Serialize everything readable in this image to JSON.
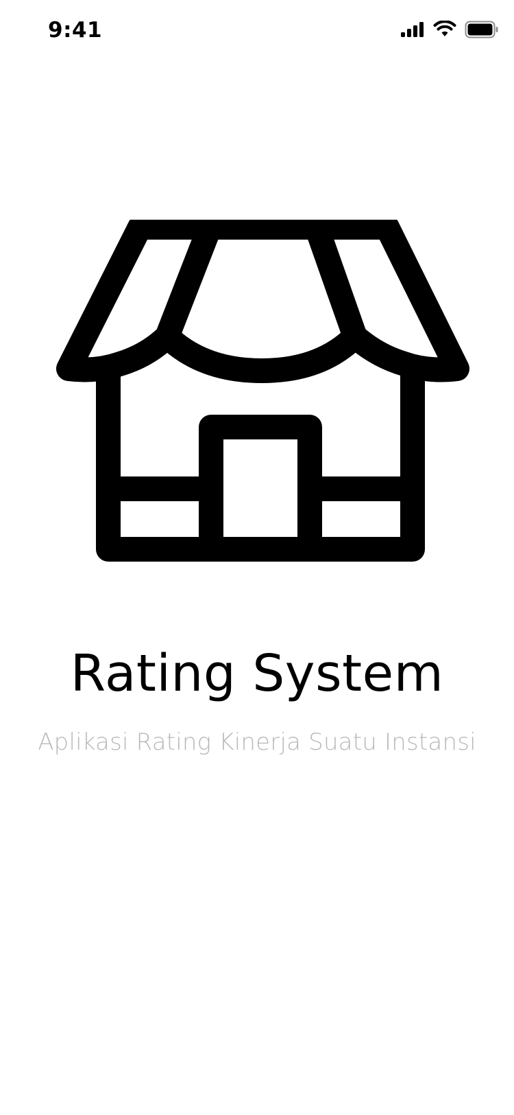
{
  "status_bar": {
    "time": "9:41",
    "signal_icon": "cellular-signal-icon",
    "wifi_icon": "wifi-icon",
    "battery_icon": "battery-icon"
  },
  "hero": {
    "icon": "storefront-icon"
  },
  "splash": {
    "title": "Rating System",
    "subtitle": "Aplikasi Rating Kinerja Suatu Instansi"
  },
  "colors": {
    "text_primary": "#000000",
    "text_secondary": "#b8b8b8",
    "background": "#ffffff"
  }
}
